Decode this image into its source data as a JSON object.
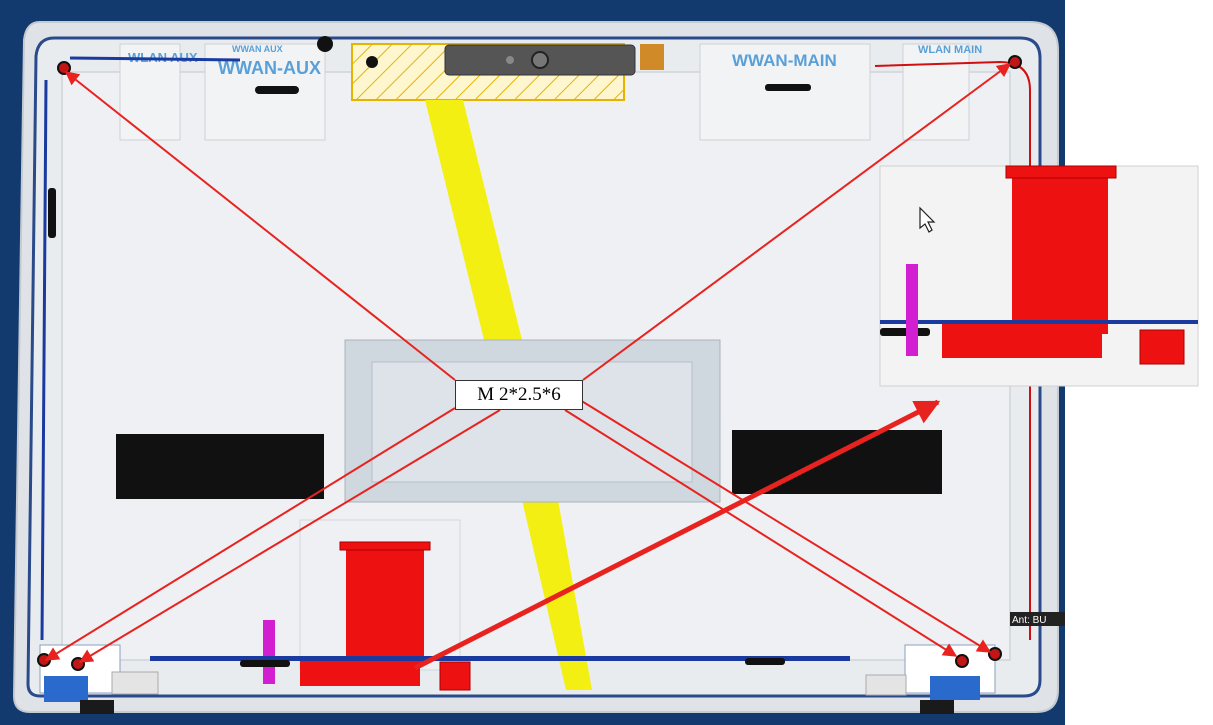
{
  "labels": {
    "wlan_aux": "WLAN AUX",
    "wwan_aux_small": "WWAN AUX",
    "wwan_aux": "WWAN-AUX",
    "wwan_main": "WWAN-MAIN",
    "wlan_main": "WLAN MAIN",
    "side_tag": "Ant: BU"
  },
  "callout": {
    "screw_spec": "M 2*2.5*6"
  },
  "colors": {
    "frame_bg": "#123a6e",
    "panel": "#eef0f3",
    "callout_arrow": "#e8231f",
    "fpc_cable": "#ee1111",
    "flex_strip": "#f4ef12",
    "antenna_label": "#5aa0d8",
    "magenta_part": "#d21fd2"
  },
  "icons": [
    "screw-icon",
    "mouse-pointer-icon",
    "arrow-icon"
  ]
}
